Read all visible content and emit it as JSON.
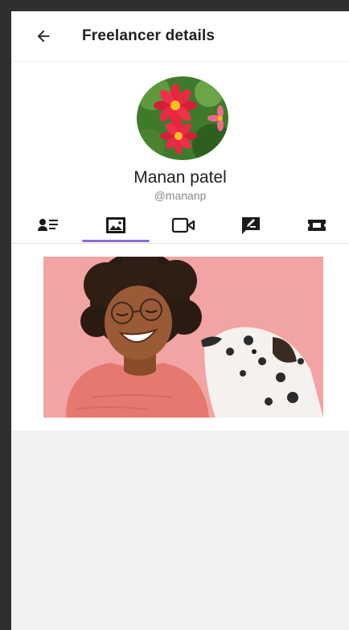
{
  "appbar": {
    "title": "Freelancer details",
    "back_icon": "arrow-left-icon"
  },
  "profile": {
    "name": "Manan patel",
    "handle": "@mananp"
  },
  "tabs": [
    {
      "id": "about",
      "icon": "person-list-icon"
    },
    {
      "id": "photos",
      "icon": "image-icon",
      "selected": true
    },
    {
      "id": "videos",
      "icon": "video-icon"
    },
    {
      "id": "reviews",
      "icon": "message-edit-icon"
    },
    {
      "id": "tickets",
      "icon": "ticket-icon"
    }
  ],
  "colors": {
    "accent": "#8e6bd8",
    "text_primary": "#1f1f1f",
    "text_secondary": "#8a8a8a",
    "background_empty": "#f2f2f2",
    "photo_background": "#f2a4a4"
  }
}
